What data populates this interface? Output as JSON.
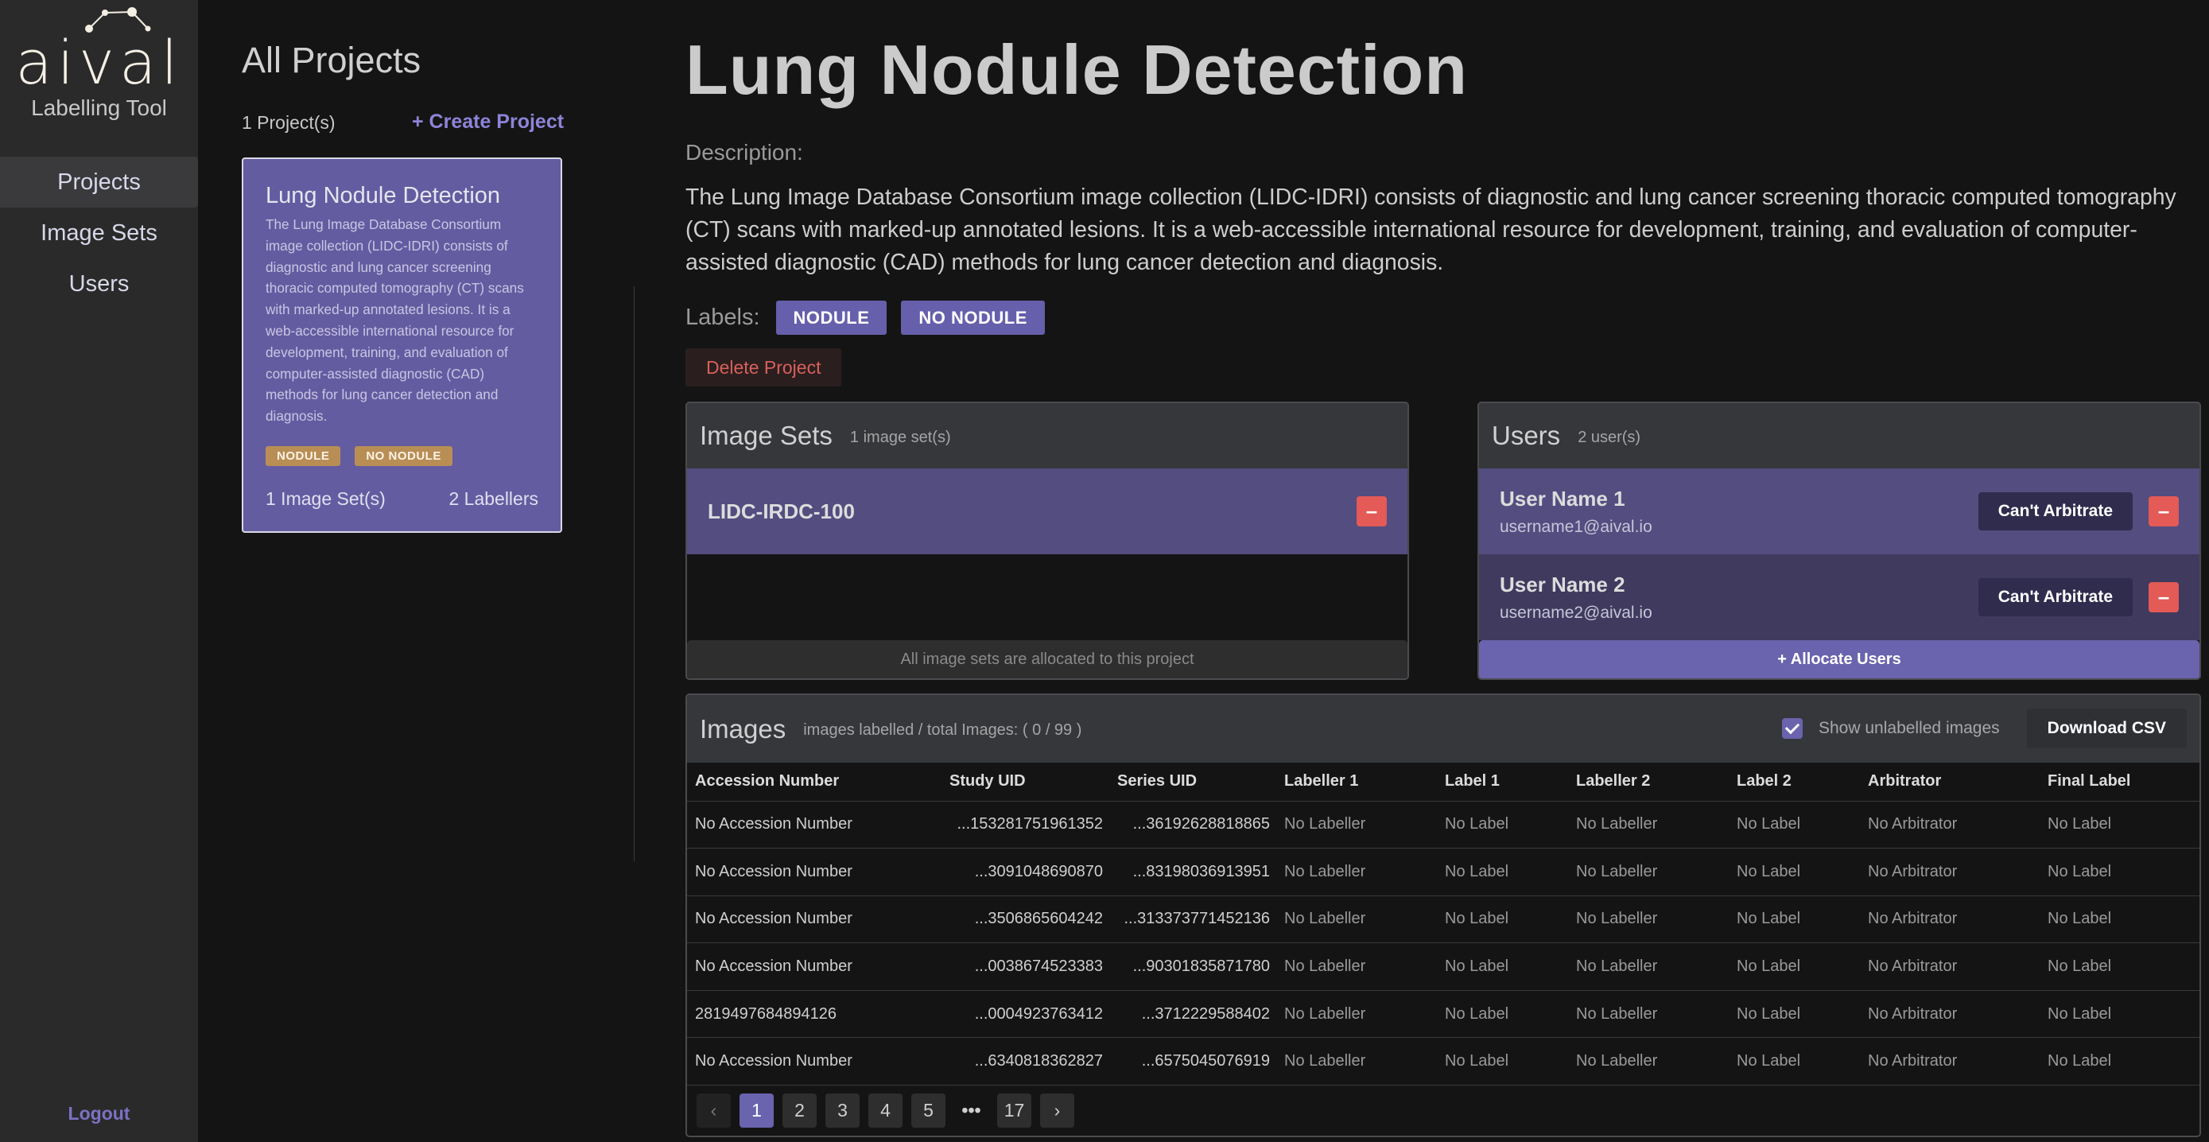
{
  "sidebar": {
    "logo_text": "aival",
    "logo_subtitle": "Labelling Tool",
    "nav": [
      {
        "label": "Projects",
        "active": true
      },
      {
        "label": "Image Sets",
        "active": false
      },
      {
        "label": "Users",
        "active": false
      }
    ],
    "logout_label": "Logout"
  },
  "projects": {
    "title": "All Projects",
    "count_label": "1 Project(s)",
    "create_label": "+ Create Project",
    "cards": [
      {
        "title": "Lung Nodule Detection",
        "description": "The Lung Image Database Consortium image collection (LIDC-IDRI) consists of diagnostic and lung cancer screening thoracic computed tomography (CT) scans with marked-up annotated lesions. It is a web-accessible international resource for development, training, and evaluation of computer-assisted diagnostic (CAD) methods for lung cancer detection and diagnosis.",
        "labels": [
          "NODULE",
          "NO NODULE"
        ],
        "image_sets": "1 Image Set(s)",
        "labellers": "2 Labellers"
      }
    ]
  },
  "project": {
    "title": "Lung Nodule Detection",
    "description_label": "Description:",
    "description": "The Lung Image Database Consortium image collection (LIDC-IDRI) consists of diagnostic and lung cancer screening thoracic computed tomography (CT) scans with marked-up annotated lesions. It is a web-accessible international resource for development, training, and evaluation of computer-assisted diagnostic (CAD) methods for lung cancer detection and diagnosis.",
    "labels_label": "Labels:",
    "labels": [
      "NODULE",
      "NO NODULE"
    ],
    "delete_label": "Delete Project"
  },
  "image_sets_panel": {
    "title": "Image Sets",
    "count": "1 image set(s)",
    "items": [
      {
        "name": "LIDC-IRDC-100"
      }
    ],
    "footer": "All image sets are allocated to this project"
  },
  "users_panel": {
    "title": "Users",
    "count": "2 user(s)",
    "items": [
      {
        "name": "User Name 1",
        "email": "username1@aival.io",
        "arbitrate_label": "Can't Arbitrate"
      },
      {
        "name": "User Name 2",
        "email": "username2@aival.io",
        "arbitrate_label": "Can't Arbitrate"
      }
    ],
    "footer": "+ Allocate Users"
  },
  "images_panel": {
    "title": "Images",
    "summary": "images labelled / total Images: ( 0 / 99 )",
    "show_unlabelled_label": "Show unlabelled images",
    "show_unlabelled_checked": true,
    "download_label": "Download CSV",
    "columns": [
      "Accession Number",
      "Study UID",
      "Series UID",
      "Labeller 1",
      "Label 1",
      "Labeller 2",
      "Label 2",
      "Arbitrator",
      "Final Label"
    ],
    "rows": [
      [
        "No Accession Number",
        "...153281751961352",
        "...36192628818865",
        "No Labeller",
        "No Label",
        "No Labeller",
        "No Label",
        "No Arbitrator",
        "No Label"
      ],
      [
        "No Accession Number",
        "...3091048690870",
        "...83198036913951",
        "No Labeller",
        "No Label",
        "No Labeller",
        "No Label",
        "No Arbitrator",
        "No Label"
      ],
      [
        "No Accession Number",
        "...3506865604242",
        "...313373771452136",
        "No Labeller",
        "No Label",
        "No Labeller",
        "No Label",
        "No Arbitrator",
        "No Label"
      ],
      [
        "No Accession Number",
        "...0038674523383",
        "...90301835871780",
        "No Labeller",
        "No Label",
        "No Labeller",
        "No Label",
        "No Arbitrator",
        "No Label"
      ],
      [
        "2819497684894126",
        "...0004923763412",
        "...3712229588402",
        "No Labeller",
        "No Label",
        "No Labeller",
        "No Label",
        "No Arbitrator",
        "No Label"
      ],
      [
        "No Accession Number",
        "...6340818362827",
        "...6575045076919",
        "No Labeller",
        "No Label",
        "No Labeller",
        "No Label",
        "No Arbitrator",
        "No Label"
      ]
    ],
    "pagination": {
      "prev_icon": "chevron-left-icon",
      "next_icon": "chevron-right-icon",
      "pages": [
        "1",
        "2",
        "3",
        "4",
        "5",
        "...",
        "17"
      ],
      "current": "1"
    }
  },
  "colors": {
    "accent": "#6a63ad",
    "card_bg": "#645ca0",
    "label_tag": "#b88e55",
    "danger": "#e35a56",
    "sidebar_bg": "#2a2a2a",
    "page_bg": "#141414"
  }
}
